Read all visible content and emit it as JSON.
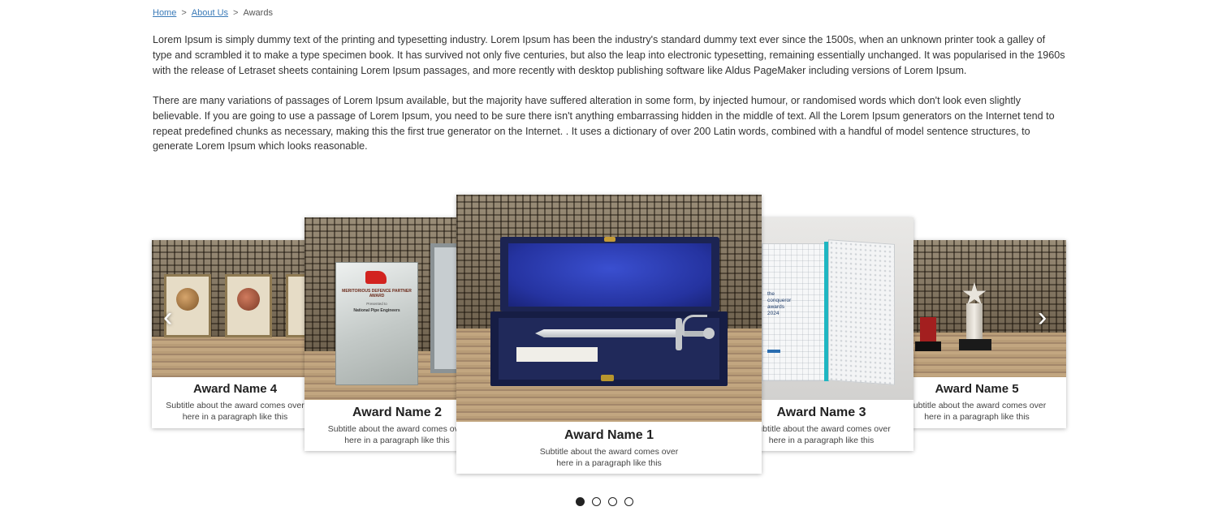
{
  "breadcrumb": {
    "items": [
      {
        "label": "Home",
        "link": true
      },
      {
        "label": "About Us",
        "link": true
      },
      {
        "label": "Awards",
        "link": false
      }
    ],
    "separator": ">"
  },
  "content": {
    "paragraph1": "Lorem Ipsum is simply dummy text of the printing and typesetting industry. Lorem Ipsum has been the industry's standard dummy text ever since the 1500s, when an unknown printer took a galley of type and scrambled it to make a type specimen book. It has survived not only five centuries, but also the leap into electronic typesetting, remaining essentially unchanged. It was popularised in the 1960s with the release of Letraset sheets containing Lorem Ipsum passages, and more recently with desktop publishing software like Aldus PageMaker including versions of Lorem Ipsum.",
    "paragraph2": "There are many variations of passages of Lorem Ipsum available, but the majority have suffered alteration in some form, by injected humour, or randomised words which don't look even slightly believable. If you are going to use a passage of Lorem Ipsum, you need to be sure there isn't anything embarrassing hidden in the middle of text. All the Lorem Ipsum generators on the Internet tend to repeat predefined chunks as necessary, making this the first true generator on the Internet. . It uses a dictionary of over 200 Latin words, combined with a handful of model sentence structures, to generate Lorem Ipsum which looks reasonable."
  },
  "carousel": {
    "cards": [
      {
        "title": "Award Name 4",
        "subtitle_line1": "Subtitle about the award comes over",
        "subtitle_line2": "here in a paragraph like this"
      },
      {
        "title": "Award Name 2",
        "subtitle_line1": "Subtitle about the award comes over",
        "subtitle_line2": "here in a paragraph like this"
      },
      {
        "title": "Award Name 1",
        "subtitle_line1": "Subtitle about the award comes over",
        "subtitle_line2": "here in a paragraph like this",
        "active": true
      },
      {
        "title": "Award Name 3",
        "subtitle_line1": "Subtitle about the award comes over",
        "subtitle_line2": "here in a paragraph like this"
      },
      {
        "title": "Award Name 5",
        "subtitle_line1": "Subtitle about the award comes over",
        "subtitle_line2": "here in a paragraph like this"
      }
    ],
    "prev_icon": "chevron-left-icon",
    "next_icon": "chevron-right-icon",
    "dots": {
      "count": 4,
      "active_index": 0
    },
    "plaque_text": {
      "heading": "MERITORIOUS DEFENCE PARTNER AWARD",
      "presented": "Presented to",
      "recipient": "National Pipe Engineers"
    },
    "certificate_text": {
      "line1": "the",
      "line2": "conqueror",
      "line3": "awards",
      "line4": "2024"
    }
  },
  "colors": {
    "link": "#3a7ab8",
    "text": "#333333",
    "velvet": "#2f3fae"
  }
}
